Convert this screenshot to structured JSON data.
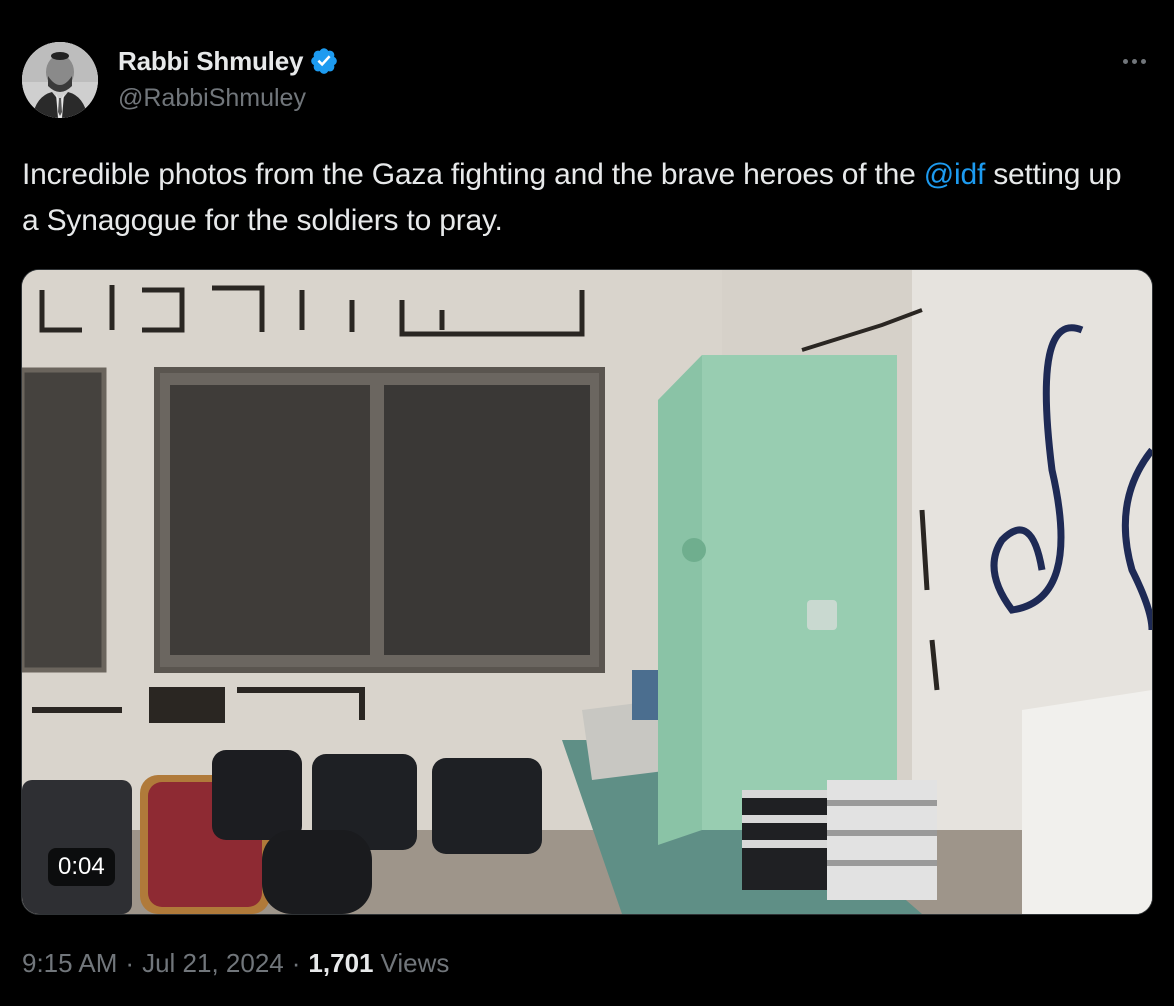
{
  "author": {
    "display_name": "Rabbi Shmuley",
    "handle": "@RabbiShmuley",
    "verified_icon": "verified-badge-icon",
    "verified_color": "#1d9bf0"
  },
  "tweet": {
    "text_before": "Incredible photos from the Gaza fighting and the brave heroes of the ",
    "mention": "@idf",
    "text_after": " setting up a Synagogue for the soldiers to pray."
  },
  "media": {
    "duration": "0:04"
  },
  "meta": {
    "time": "9:15 AM",
    "separator1": "·",
    "date": "Jul 21, 2024",
    "separator2": "·",
    "views_count": "1,701",
    "views_label": "Views"
  },
  "colors": {
    "background": "#000000",
    "text_primary": "#e7e9ea",
    "text_secondary": "#71767b",
    "link": "#1d9bf0"
  }
}
